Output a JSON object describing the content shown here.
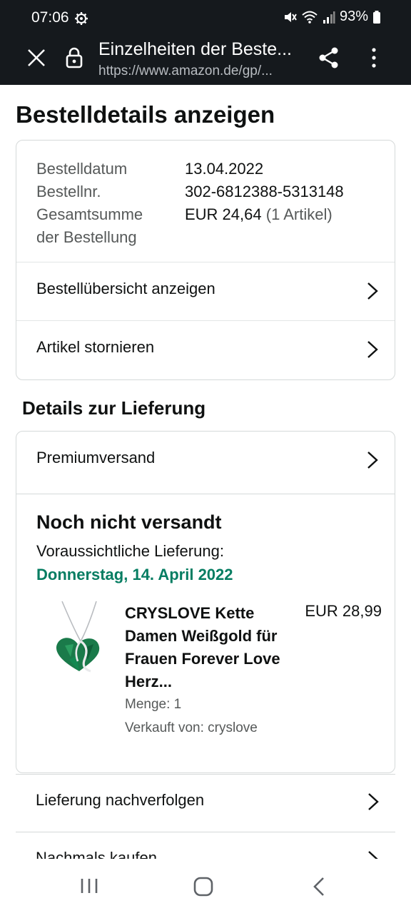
{
  "status_bar": {
    "time": "07:06",
    "battery": "93%"
  },
  "browser": {
    "title": "Einzelheiten der Beste...",
    "url": "https://www.amazon.de/gp/..."
  },
  "page": {
    "title": "Bestelldetails anzeigen"
  },
  "order_summary": {
    "date_label": "Bestelldatum",
    "date_value": "13.04.2022",
    "number_label": "Bestellnr.",
    "number_value": "302-6812388-5313148",
    "total_label_line1": "Gesamtsumme",
    "total_label_line2": "der Bestellung",
    "total_value": "EUR 24,64",
    "total_items": "(1 Artikel)"
  },
  "order_links": [
    {
      "label": "Bestellübersicht anzeigen"
    },
    {
      "label": "Artikel stornieren"
    }
  ],
  "delivery": {
    "section_title": "Details zur Lieferung",
    "shipping_method": "Premiumversand",
    "status": "Noch nicht versandt",
    "estimate_label": "Voraussichtliche Lieferung:",
    "estimate_date": "Donnerstag, 14. April 2022",
    "accent_color": "#067d62",
    "product": {
      "name": "CRYSLOVE Kette Damen Weißgold für Frauen Forever Love Herz...",
      "price": "EUR 28,99",
      "quantity": "Menge: 1",
      "seller": "Verkauft von: cryslove"
    }
  },
  "bottom_links": [
    {
      "label": "Lieferung nachverfolgen"
    },
    {
      "label": "Nachmals kaufen"
    }
  ],
  "icons": {
    "settings": "gear-icon",
    "close": "close-icon",
    "lock": "lock-icon",
    "share": "share-icon",
    "more": "more-vert-icon",
    "chevron": "chevron-right-icon",
    "nav_recent": "recent-apps-icon",
    "nav_home": "home-icon",
    "nav_back": "back-icon"
  }
}
